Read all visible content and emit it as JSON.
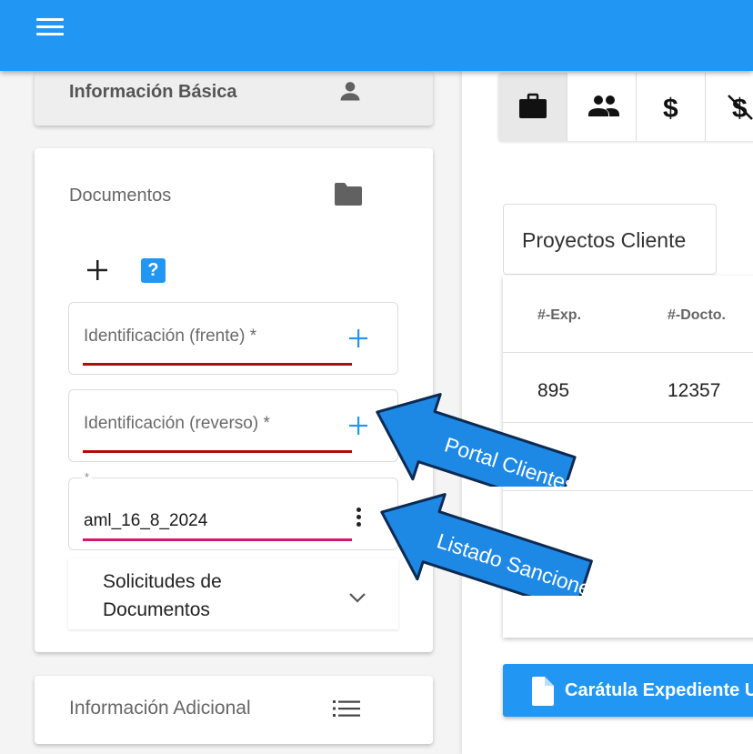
{
  "colors": {
    "brand": "#2196f3",
    "error_underline": "#b00d0d",
    "focus_underline": "#d6166e",
    "callout": "#1e88e5"
  },
  "topbar": {
    "menu_icon": "hamburger-menu-icon"
  },
  "left": {
    "basic_info": {
      "title": "Información Básica",
      "icon": "person-icon"
    },
    "documents": {
      "title": "Documentos",
      "icon": "folder-icon",
      "actions": {
        "add_icon": "plus-icon",
        "help_icon": "help-icon",
        "help_label": "?"
      },
      "fields": [
        {
          "label": "Identificación (frente) *",
          "action_icon": "plus-icon"
        },
        {
          "label": "Identificación (reverso) *",
          "action_icon": "plus-icon"
        },
        {
          "label": "*",
          "value": "aml_16_8_2024",
          "action_icon": "more-vertical-icon"
        }
      ],
      "requests": {
        "label_line1": "Solicitudes de",
        "label_line2": "Documentos",
        "icon": "chevron-down-icon"
      }
    },
    "additional_info": {
      "title": "Información Adicional",
      "icon": "list-icon"
    }
  },
  "right": {
    "tabs": [
      {
        "icon": "briefcase-icon",
        "active": true
      },
      {
        "icon": "people-icon",
        "active": false
      },
      {
        "icon": "dollar-icon",
        "active": false
      },
      {
        "icon": "dollar-off-icon",
        "active": false
      }
    ],
    "projects_button": "Proyectos Cliente",
    "table": {
      "columns": [
        "#-Exp.",
        "#-Docto."
      ],
      "rows": [
        [
          "895",
          "12357"
        ]
      ]
    },
    "caratula_button": {
      "label": "Carátula Expediente U",
      "icon": "document-icon"
    }
  },
  "callouts": {
    "portal": "Portal Clientes",
    "sanciones": "Listado Sanciones"
  }
}
